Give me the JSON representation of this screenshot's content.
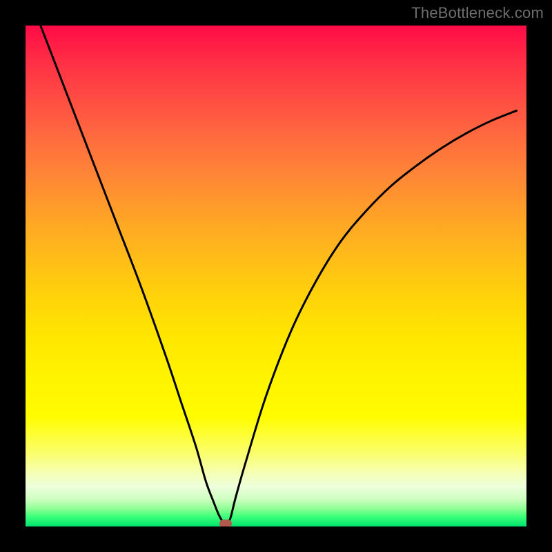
{
  "watermark": "TheBottleneck.com",
  "colors": {
    "frame": "#000000",
    "curve": "#000000",
    "min_marker": "#b35a4e",
    "gradient_top": "#ff0a46",
    "gradient_bottom": "#00e36e"
  },
  "chart_data": {
    "type": "line",
    "title": "",
    "xlabel": "",
    "ylabel": "",
    "xlim": [
      0,
      100
    ],
    "ylim": [
      0,
      100
    ],
    "x": [
      3,
      8,
      13,
      18,
      23,
      28,
      31,
      34,
      36,
      37.5,
      38.5,
      39.2,
      39.8,
      40.1,
      40.5,
      41,
      42,
      44,
      48,
      53,
      58,
      63,
      68,
      73,
      78,
      83,
      88,
      93,
      98
    ],
    "values": [
      100,
      87,
      74,
      61,
      48,
      34,
      25,
      16,
      9,
      5,
      2.5,
      1.2,
      0.5,
      0.5,
      0.8,
      2,
      6,
      13,
      26,
      39,
      49,
      57,
      63,
      68,
      72,
      75.5,
      78.5,
      81,
      83
    ],
    "min_point": {
      "x": 40,
      "y": 0.5
    },
    "notes": "V-shaped bottleneck curve; x and y axes have no visible tick labels or units; gradient background encodes value from red (high/bad) at top to green (low/good) at bottom; minimum marked with small rounded rectangle."
  }
}
